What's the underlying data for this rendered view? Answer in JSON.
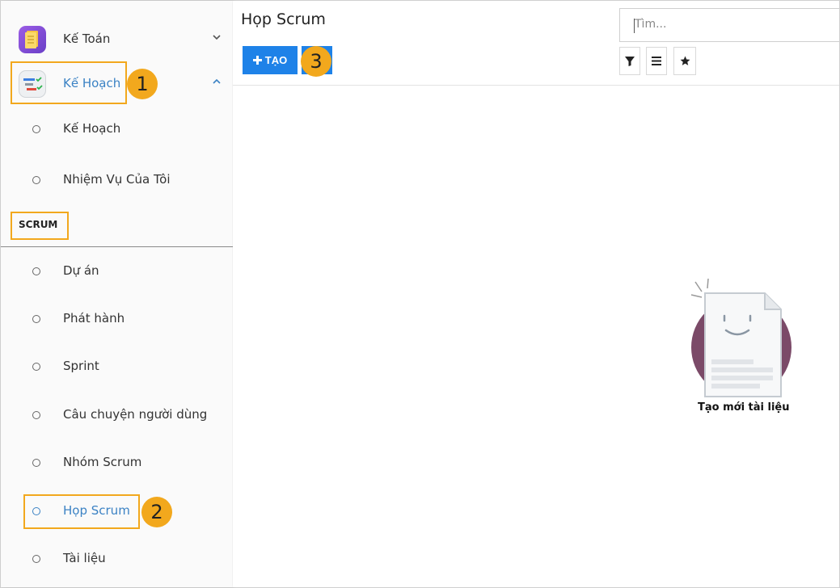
{
  "sidebar": {
    "apps": [
      {
        "label": "Kế Toán",
        "icon": "ledger-app-icon"
      },
      {
        "label": "Kế Hoạch",
        "icon": "planning-app-icon"
      }
    ],
    "plan_items": [
      {
        "label": "Kế Hoạch"
      },
      {
        "label": "Nhiệm Vụ Của Tôi"
      }
    ],
    "section_label": "SCRUM",
    "scrum_items": [
      {
        "label": "Dự án"
      },
      {
        "label": "Phát hành"
      },
      {
        "label": "Sprint"
      },
      {
        "label": "Câu chuyện người dùng"
      },
      {
        "label": "Nhóm Scrum"
      },
      {
        "label": "Họp Scrum"
      },
      {
        "label": "Tài liệu"
      }
    ]
  },
  "annotations": [
    "1",
    "2",
    "3"
  ],
  "main": {
    "title": "Họp Scrum",
    "create_label": "TẠO",
    "search_placeholder": "Tìm...",
    "empty_label": "Tạo mới tài liệu"
  },
  "colors": {
    "accent": "#1e82e8",
    "active_text": "#3b82c4",
    "highlight": "#f2a81d",
    "empty_circle": "#7b4a68"
  }
}
